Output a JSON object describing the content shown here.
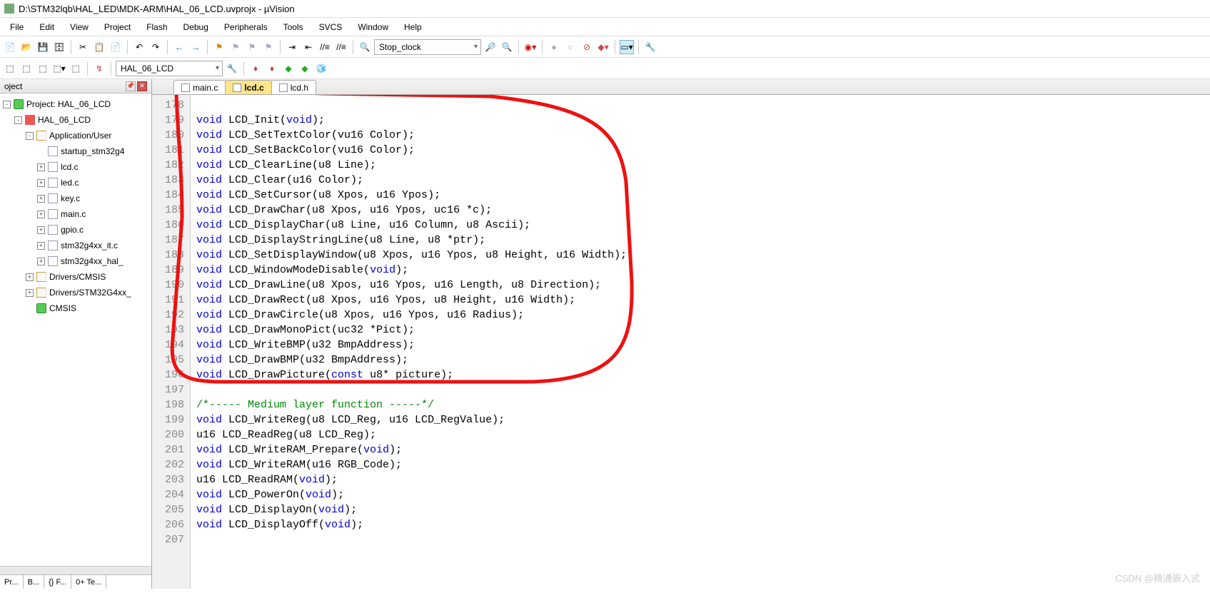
{
  "title": "D:\\STM32lqb\\HAL_LED\\MDK-ARM\\HAL_06_LCD.uvprojx - µVision",
  "appname": "µVision",
  "menu": [
    "File",
    "Edit",
    "View",
    "Project",
    "Flash",
    "Debug",
    "Peripherals",
    "Tools",
    "SVCS",
    "Window",
    "Help"
  ],
  "toolbar1": {
    "find_combo": "Stop_clock"
  },
  "toolbar2": {
    "target_combo": "HAL_06_LCD"
  },
  "project_pane": {
    "title": "oject",
    "tree": [
      {
        "depth": 0,
        "exp": "-",
        "icon": "cube",
        "label": "Project: HAL_06_LCD"
      },
      {
        "depth": 1,
        "exp": "-",
        "icon": "redbox",
        "label": "HAL_06_LCD"
      },
      {
        "depth": 2,
        "exp": "-",
        "icon": "fold",
        "label": "Application/User"
      },
      {
        "depth": 3,
        "exp": " ",
        "icon": "file",
        "label": "startup_stm32g4"
      },
      {
        "depth": 3,
        "exp": "+",
        "icon": "file",
        "label": "lcd.c"
      },
      {
        "depth": 3,
        "exp": "+",
        "icon": "file",
        "label": "led.c"
      },
      {
        "depth": 3,
        "exp": "+",
        "icon": "file",
        "label": "key.c"
      },
      {
        "depth": 3,
        "exp": "+",
        "icon": "file",
        "label": "main.c"
      },
      {
        "depth": 3,
        "exp": "+",
        "icon": "file",
        "label": "gpio.c"
      },
      {
        "depth": 3,
        "exp": "+",
        "icon": "file",
        "label": "stm32g4xx_it.c"
      },
      {
        "depth": 3,
        "exp": "+",
        "icon": "file",
        "label": "stm32g4xx_hal_"
      },
      {
        "depth": 2,
        "exp": "+",
        "icon": "fold",
        "label": "Drivers/CMSIS"
      },
      {
        "depth": 2,
        "exp": "+",
        "icon": "fold",
        "label": "Drivers/STM32G4xx_"
      },
      {
        "depth": 2,
        "exp": " ",
        "icon": "cube",
        "label": "CMSIS"
      }
    ],
    "bottom_tabs": [
      "Pr...",
      "B...",
      "{} F...",
      "0+ Te..."
    ]
  },
  "editor": {
    "tabs": [
      {
        "label": "main.c",
        "active": false
      },
      {
        "label": "lcd.c",
        "active": true
      },
      {
        "label": "lcd.h",
        "active": false
      }
    ],
    "first_line": 178,
    "lines": [
      {
        "raw": ""
      },
      {
        "kw": "void",
        "rest": " LCD_Init(",
        "kw2": "void",
        "tail": ");"
      },
      {
        "kw": "void",
        "rest": " LCD_SetTextColor(vu16 Color);"
      },
      {
        "kw": "void",
        "rest": " LCD_SetBackColor(vu16 Color);"
      },
      {
        "kw": "void",
        "rest": " LCD_ClearLine(u8 Line);"
      },
      {
        "kw": "void",
        "rest": " LCD_Clear(u16 Color);"
      },
      {
        "kw": "void",
        "rest": " LCD_SetCursor(u8 Xpos, u16 Ypos);"
      },
      {
        "kw": "void",
        "rest": " LCD_DrawChar(u8 Xpos, u16 Ypos, uc16 *c);"
      },
      {
        "kw": "void",
        "rest": " LCD_DisplayChar(u8 Line, u16 Column, u8 Ascii);"
      },
      {
        "kw": "void",
        "rest": " LCD_DisplayStringLine(u8 Line, u8 *ptr);"
      },
      {
        "kw": "void",
        "rest": " LCD_SetDisplayWindow(u8 Xpos, u16 Ypos, u8 Height, u16 Width);"
      },
      {
        "kw": "void",
        "rest": " LCD_WindowModeDisable(",
        "kw2": "void",
        "tail": ");"
      },
      {
        "kw": "void",
        "rest": " LCD_DrawLine(u8 Xpos, u16 Ypos, u16 Length, u8 Direction);"
      },
      {
        "kw": "void",
        "rest": " LCD_DrawRect(u8 Xpos, u16 Ypos, u8 Height, u16 Width);"
      },
      {
        "kw": "void",
        "rest": " LCD_DrawCircle(u8 Xpos, u16 Ypos, u16 Radius);"
      },
      {
        "kw": "void",
        "rest": " LCD_DrawMonoPict(uc32 *Pict);"
      },
      {
        "kw": "void",
        "rest": " LCD_WriteBMP(u32 BmpAddress);"
      },
      {
        "kw": "void",
        "rest": " LCD_DrawBMP(u32 BmpAddress);"
      },
      {
        "kw": "void",
        "rest": " LCD_DrawPicture(",
        "kw2": "const",
        "tail": " u8* picture);"
      },
      {
        "raw": ""
      },
      {
        "cm": "/*----- Medium layer function -----*/"
      },
      {
        "kw": "void",
        "rest": " LCD_WriteReg(u8 LCD_Reg, u16 LCD_RegValue);"
      },
      {
        "raw": "u16 LCD_ReadReg(u8 LCD_Reg);"
      },
      {
        "kw": "void",
        "rest": " LCD_WriteRAM_Prepare(",
        "kw2": "void",
        "tail": ");"
      },
      {
        "kw": "void",
        "rest": " LCD_WriteRAM(u16 RGB_Code);"
      },
      {
        "raw": "u16 LCD_ReadRAM(",
        "kw2": "void",
        "tail": ");"
      },
      {
        "kw": "void",
        "rest": " LCD_PowerOn(",
        "kw2": "void",
        "tail": ");"
      },
      {
        "kw": "void",
        "rest": " LCD_DisplayOn(",
        "kw2": "void",
        "tail": ");"
      },
      {
        "kw": "void",
        "rest": " LCD_DisplayOff(",
        "kw2": "void",
        "tail": ");"
      },
      {
        "raw": ""
      }
    ]
  },
  "watermark": "CSDN @精通嵌入式"
}
